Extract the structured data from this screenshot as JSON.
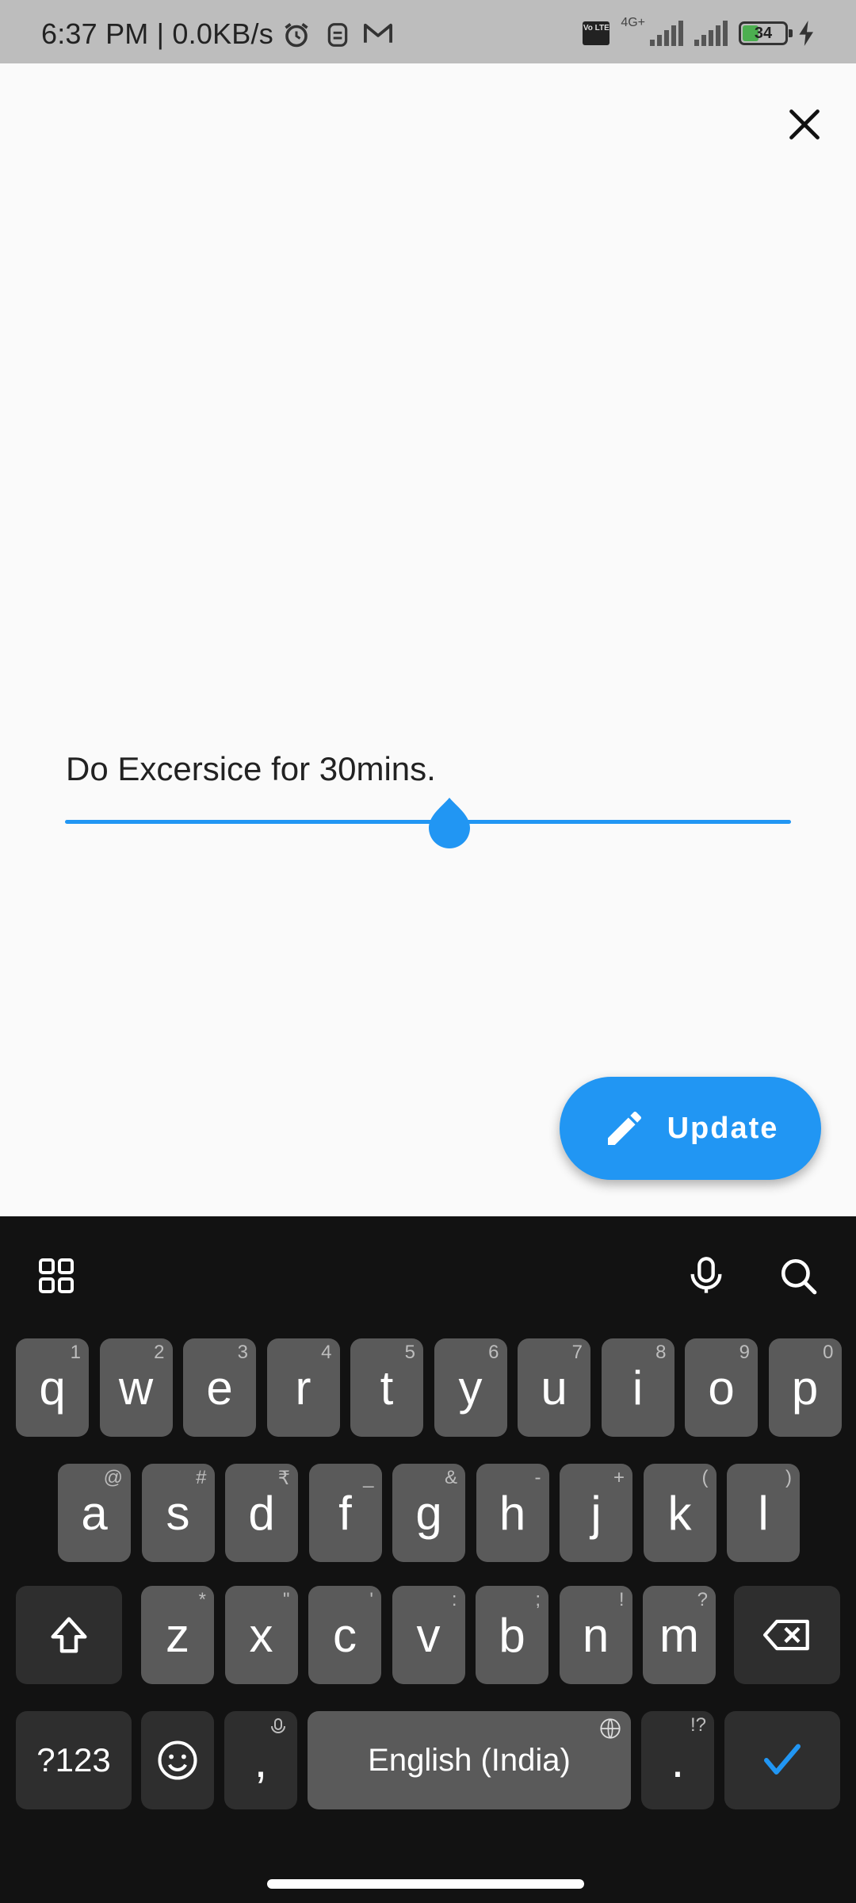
{
  "status_bar": {
    "time": "6:37 PM | 0.0KB/s",
    "network_type": "4G+",
    "volte": "Vo LTE",
    "battery": "34",
    "icons": [
      "alarm-icon",
      "assistant-icon",
      "gmail-icon",
      "signal-icon",
      "charging-icon"
    ]
  },
  "task": {
    "text": "Do Excersice for 30mins.",
    "progress_fraction": 0.53
  },
  "fab": {
    "label": "Update",
    "icon": "edit-pencil-icon"
  },
  "keyboard": {
    "row1": [
      {
        "k": "q",
        "h": "1"
      },
      {
        "k": "w",
        "h": "2"
      },
      {
        "k": "e",
        "h": "3"
      },
      {
        "k": "r",
        "h": "4"
      },
      {
        "k": "t",
        "h": "5"
      },
      {
        "k": "y",
        "h": "6"
      },
      {
        "k": "u",
        "h": "7"
      },
      {
        "k": "i",
        "h": "8"
      },
      {
        "k": "o",
        "h": "9"
      },
      {
        "k": "p",
        "h": "0"
      }
    ],
    "row2": [
      {
        "k": "a",
        "h": "@"
      },
      {
        "k": "s",
        "h": "#"
      },
      {
        "k": "d",
        "h": "₹"
      },
      {
        "k": "f",
        "h": "_"
      },
      {
        "k": "g",
        "h": "&"
      },
      {
        "k": "h",
        "h": "-"
      },
      {
        "k": "j",
        "h": "+"
      },
      {
        "k": "k",
        "h": "("
      },
      {
        "k": "l",
        "h": ")"
      }
    ],
    "row3": [
      {
        "k": "z",
        "h": "*"
      },
      {
        "k": "x",
        "h": "\""
      },
      {
        "k": "c",
        "h": "'"
      },
      {
        "k": "v",
        "h": ":"
      },
      {
        "k": "b",
        "h": ";"
      },
      {
        "k": "n",
        "h": "!"
      },
      {
        "k": "m",
        "h": "?"
      }
    ],
    "symbols_label": "?123",
    "comma": ",",
    "space_label": "English (India)",
    "period": ".",
    "period_hint": "!?"
  },
  "colors": {
    "accent": "#2196f3",
    "keyboard_bg": "#121212",
    "key_bg": "#5a5a5a"
  }
}
